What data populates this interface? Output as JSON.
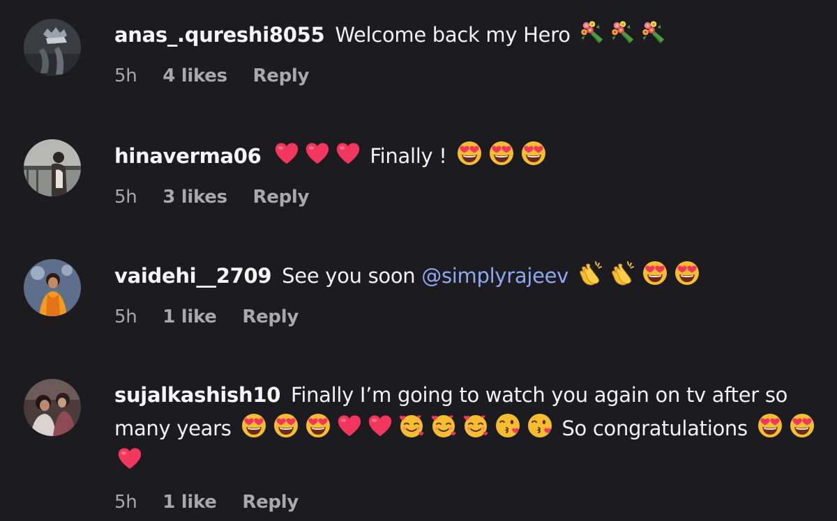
{
  "comments": [
    {
      "username": "anas_.qureshi8055",
      "text": "Welcome back my Hero",
      "emojis": [
        "bouquet-icon",
        "bouquet-icon",
        "bouquet-icon"
      ],
      "time": "5h",
      "likes": "4 likes",
      "reply": "Reply"
    },
    {
      "username": "hinaverma06",
      "emojis_before": [
        "heart-icon",
        "heart-icon",
        "heart-icon"
      ],
      "text": "Finally !",
      "emojis": [
        "heart-eyes-icon",
        "heart-eyes-icon",
        "heart-eyes-icon"
      ],
      "time": "5h",
      "likes": "3 likes",
      "reply": "Reply"
    },
    {
      "username": "vaidehi__2709",
      "text": "See you soon",
      "mention": "@simplyrajeev",
      "emojis": [
        "clapping-hands-icon",
        "clapping-hands-icon",
        "heart-eyes-icon",
        "heart-eyes-icon"
      ],
      "time": "5h",
      "likes": "1 like",
      "reply": "Reply"
    },
    {
      "username": "sujalkashish10",
      "text": "Finally I’m going to watch you again on tv after so many years",
      "emojis": [
        "heart-eyes-icon",
        "heart-eyes-icon",
        "heart-eyes-icon",
        "heart-icon",
        "heart-icon",
        "smiling-hearts-icon",
        "smiling-hearts-icon",
        "smiling-hearts-icon",
        "kissing-face-icon",
        "kissing-face-icon"
      ],
      "text2": "So congratulations",
      "emojis2": [
        "heart-eyes-icon",
        "heart-eyes-icon",
        "heart-icon"
      ],
      "time": "5h",
      "likes": "1 like",
      "reply": "Reply"
    }
  ],
  "colors": {
    "background": "#1c1c20",
    "text": "#f2f2f2",
    "meta": "#a8a8ad",
    "mention": "#8ea8f2",
    "heart": "#f2365c",
    "emoji-face": "#f6bd30"
  }
}
